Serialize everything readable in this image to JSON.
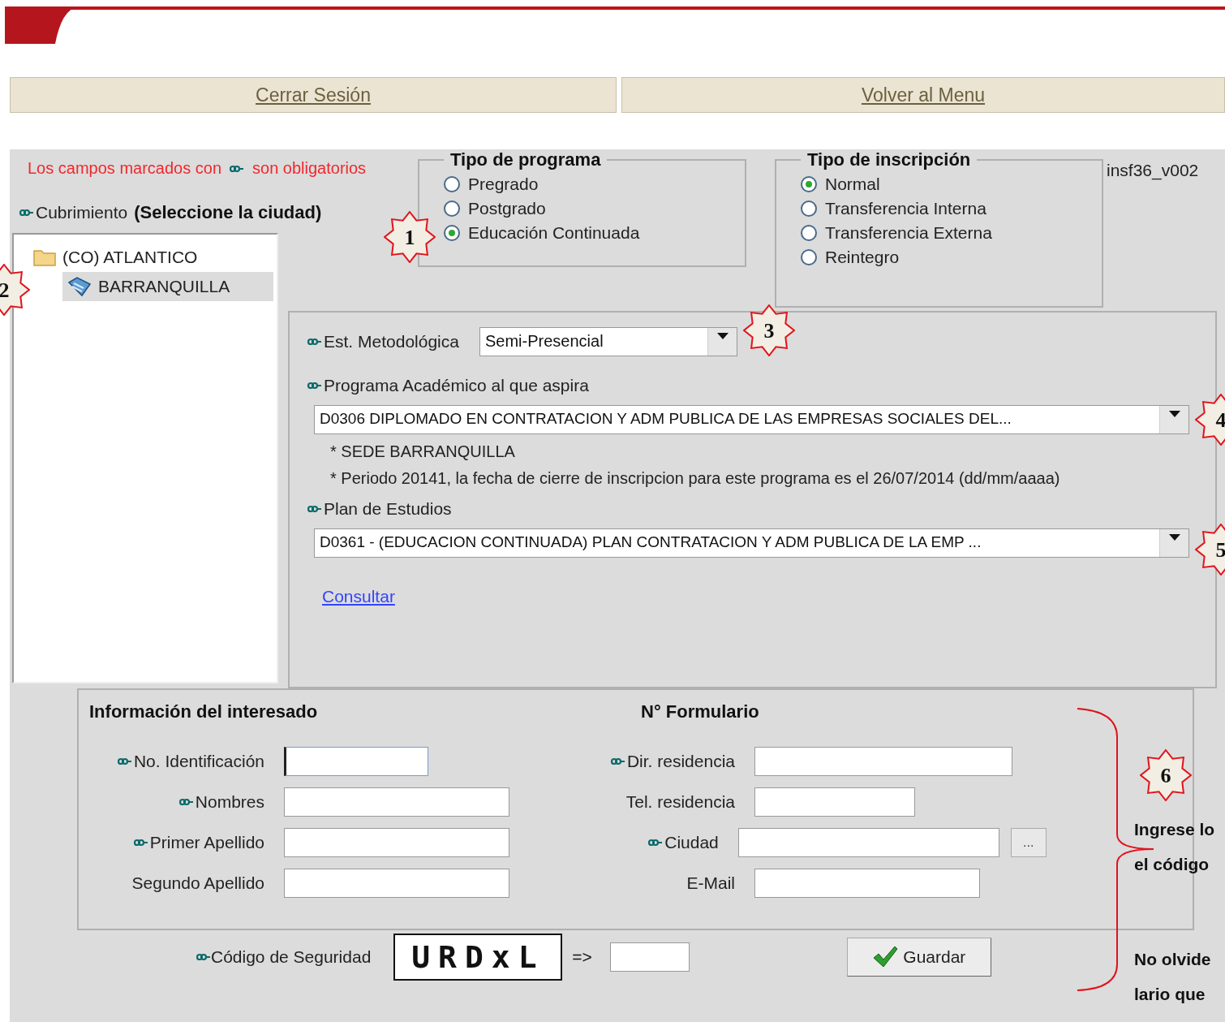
{
  "nav": [
    {
      "label": "Cerrar Sesión"
    },
    {
      "label": "Volver al Menu"
    }
  ],
  "required_note": {
    "before": "Los campos marcados con",
    "after": "son obligatorios"
  },
  "coverage": {
    "label": "Cubrimiento",
    "hint": "(Seleccione la ciudad)",
    "required": true,
    "tree": [
      {
        "label": "(CO) ATLANTICO",
        "kind": "folder",
        "selected": false,
        "children": [
          {
            "label": "BARRANQUILLA",
            "kind": "city",
            "selected": true
          }
        ]
      }
    ]
  },
  "program_type": {
    "legend": "Tipo de programa",
    "options": [
      {
        "label": "Pregrado",
        "selected": false
      },
      {
        "label": "Postgrado",
        "selected": false
      },
      {
        "label": "Educación Continuada",
        "selected": true
      }
    ]
  },
  "enrollment_type": {
    "legend": "Tipo de inscripción",
    "options": [
      {
        "label": "Normal",
        "selected": true
      },
      {
        "label": "Transferencia Interna",
        "selected": false
      },
      {
        "label": "Transferencia Externa",
        "selected": false
      },
      {
        "label": "Reintegro",
        "selected": false
      }
    ]
  },
  "version": "insf36_v002",
  "methodology": {
    "label": "Est. Metodológica",
    "value": "Semi-Presencial",
    "required": true
  },
  "program": {
    "label": "Programa Académico al que aspira",
    "value": "D0306 DIPLOMADO EN CONTRATACION Y ADM PUBLICA DE LAS EMPRESAS SOCIALES DEL...",
    "required": true
  },
  "program_notes": [
    "* SEDE BARRANQUILLA",
    "* Periodo 20141, la fecha de cierre de inscripcion para este programa es el 26/07/2014 (dd/mm/aaaa)"
  ],
  "plan": {
    "label": "Plan de Estudios",
    "value": "D0361 - (EDUCACION CONTINUADA) PLAN CONTRATACION Y ADM PUBLICA DE LA EMP ...",
    "required": true
  },
  "consult_link": "Consultar",
  "applicant": {
    "title": "Información del interesado",
    "form_number_label": "N° Formulario",
    "left": [
      {
        "label": "No. Identificación",
        "required": true,
        "focused": true
      },
      {
        "label": "Nombres",
        "required": true,
        "focused": false
      },
      {
        "label": "Primer Apellido",
        "required": true,
        "focused": false
      },
      {
        "label": "Segundo Apellido",
        "required": false,
        "focused": false
      }
    ],
    "right": [
      {
        "label": "Dir. residencia",
        "required": true,
        "focused": false,
        "kind": "text"
      },
      {
        "label": "Tel. residencia",
        "required": false,
        "focused": false,
        "kind": "text"
      },
      {
        "label": "Ciudad",
        "required": true,
        "focused": false,
        "kind": "lookup",
        "button": "..."
      },
      {
        "label": "E-Mail",
        "required": false,
        "focused": false,
        "kind": "text"
      }
    ]
  },
  "security": {
    "label": "Código de Seguridad",
    "required": true,
    "code": "URDxL",
    "arrow": "=>"
  },
  "save_button": "Guardar",
  "annotations": {
    "markers": [
      "1",
      "2",
      "3",
      "4",
      "5",
      "6"
    ],
    "notes": [
      [
        "Ingrese lo",
        "el código"
      ],
      [
        "No olvide",
        "lario que"
      ]
    ]
  }
}
